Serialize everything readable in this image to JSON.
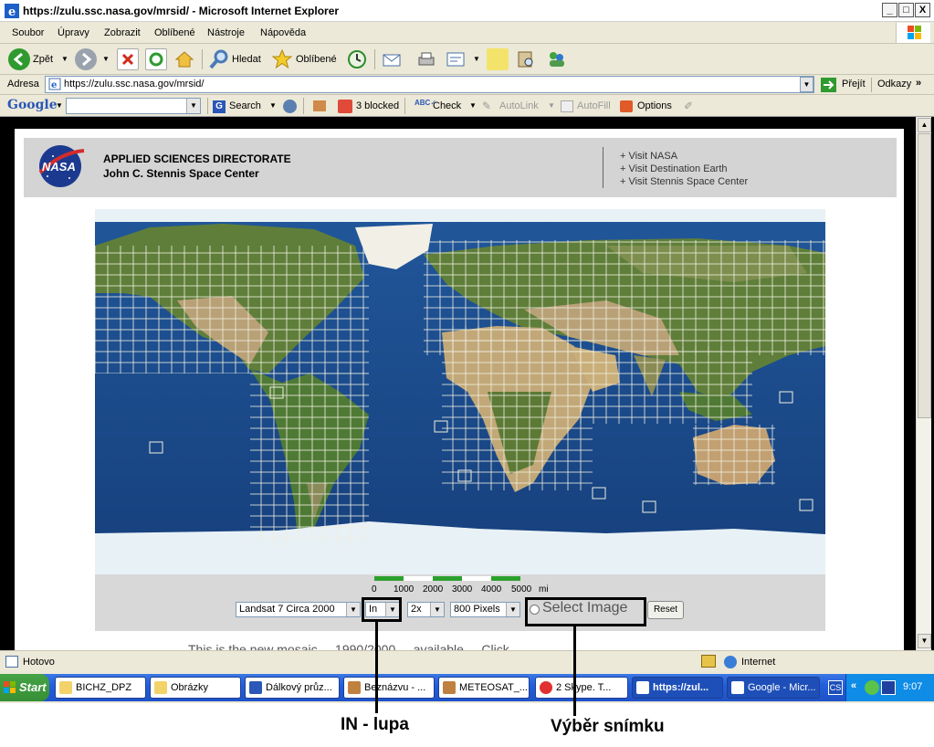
{
  "window": {
    "title": "https://zulu.ssc.nasa.gov/mrsid/ - Microsoft Internet Explorer",
    "buttons": {
      "minimize": "_",
      "maximize": "□",
      "close": "X"
    }
  },
  "menu": [
    "Soubor",
    "Úpravy",
    "Zobrazit",
    "Oblíbené",
    "Nástroje",
    "Nápověda"
  ],
  "toolbar": {
    "back": "Zpět",
    "search": "Hledat",
    "favorites": "Oblíbené"
  },
  "address": {
    "label": "Adresa",
    "url": "https://zulu.ssc.nasa.gov/mrsid/",
    "go": "Přejít",
    "links": "Odkazy"
  },
  "google_bar": {
    "logo": "Google",
    "search": "Search",
    "blocked": "3 blocked",
    "check": "Check",
    "autolink": "AutoLink",
    "autofill": "AutoFill",
    "options": "Options"
  },
  "page": {
    "logo_text": "NASA",
    "directorate": "APPLIED SCIENCES DIRECTORATE",
    "center": "John C. Stennis Space Center",
    "links": [
      "+ Visit NASA",
      "+ Visit Destination Earth",
      "+ Visit Stennis Space Center"
    ],
    "scale_labels": [
      "0",
      "1000",
      "2000",
      "3000",
      "4000",
      "5000"
    ],
    "scale_unit": "mi",
    "controls": {
      "dataset": "Landsat 7 Circa 2000",
      "zoom_mode": "In",
      "zoom_factor": "2x",
      "size": "800 Pixels",
      "select_image": "Select Image",
      "reset": "Reset"
    },
    "bottom_text": "This is the new mosaic ... 1990/2000 ... available ... Click"
  },
  "status": {
    "text": "Hotovo",
    "zone": "Internet"
  },
  "taskbar": {
    "start": "Start",
    "tasks": [
      "BICHZ_DPZ",
      "Obrázky",
      "Dálkový průz...",
      "Beznázvu - ...",
      "METEOSAT_...",
      "2 Skype. T...",
      "https://zul...",
      "Google - Micr..."
    ],
    "tray_label": "CS",
    "clock": "9:07"
  },
  "annotations": {
    "zoom": "IN - lupa",
    "select": "Výběr snímku"
  },
  "colors": {
    "ocean": "#1a4f8f",
    "land_dark": "#5f7e3a",
    "land_desert": "#c2a878",
    "ice": "#e8f1f6",
    "grid": "#f0f0e0"
  }
}
